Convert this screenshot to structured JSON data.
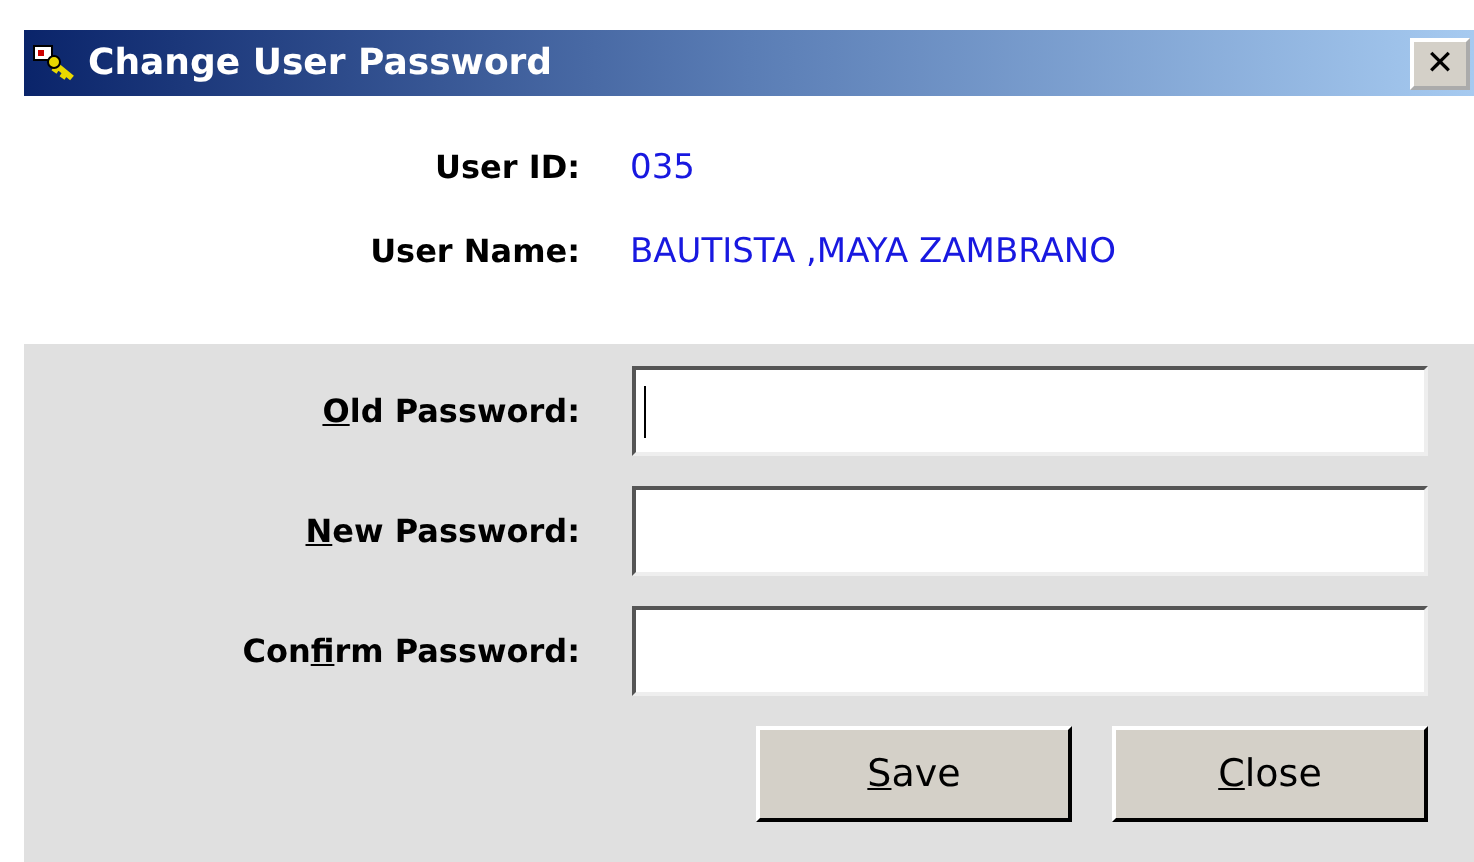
{
  "window": {
    "title": "Change User Password",
    "close_glyph": "✕"
  },
  "info": [
    {
      "label": "User ID:",
      "value": "035"
    },
    {
      "label": "User Name:",
      "value": "BAUTISTA ,MAYA ZAMBRANO"
    }
  ],
  "fields": [
    {
      "label": [
        {
          "text": "O",
          "underlined": true
        },
        {
          "text": "ld Password:",
          "underlined": false
        }
      ],
      "focused": true
    },
    {
      "label": [
        {
          "text": "N",
          "underlined": true
        },
        {
          "text": "ew Password:",
          "underlined": false
        }
      ],
      "focused": false
    },
    {
      "label": [
        {
          "text": "Con",
          "underlined": false
        },
        {
          "text": "f",
          "underlined": true
        },
        {
          "text": "irm Password:",
          "underlined": false
        }
      ],
      "focused": false
    }
  ],
  "buttons": [
    {
      "label": [
        {
          "text": "S",
          "underlined": true
        },
        {
          "text": "ave",
          "underlined": false
        }
      ]
    },
    {
      "label": [
        {
          "text": "C",
          "underlined": true
        },
        {
          "text": "lose",
          "underlined": false
        }
      ]
    }
  ]
}
